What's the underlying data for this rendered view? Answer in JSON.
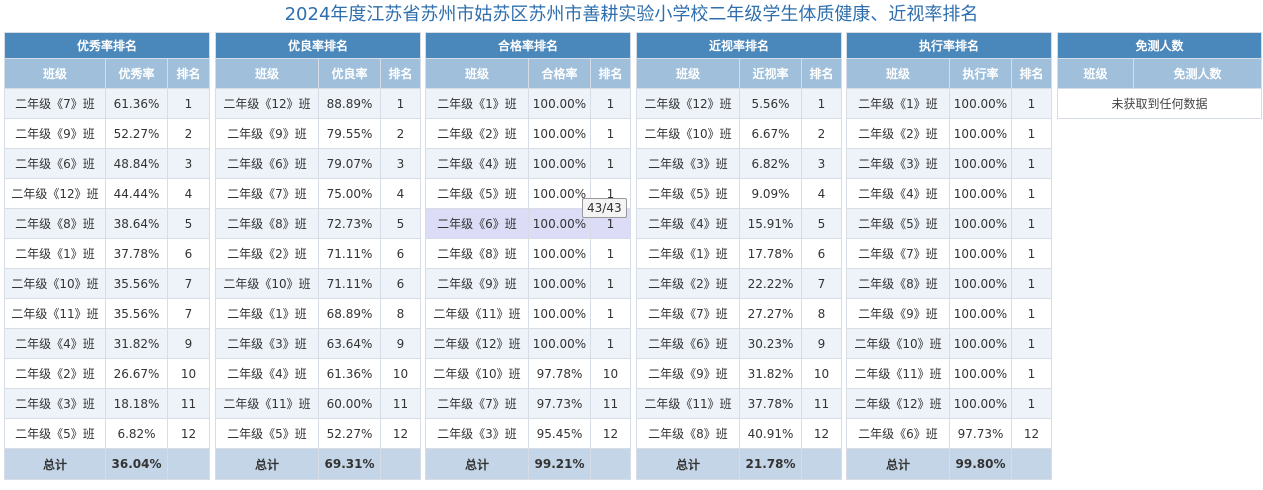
{
  "page": {
    "title": "2024年度江苏省苏州市姑苏区苏州市善耕实验小学校二年级学生体质健康、近视率排名"
  },
  "tables": [
    {
      "title": "优秀率排名",
      "columns": [
        "班级",
        "优秀率",
        "排名"
      ],
      "rows": [
        [
          "二年级《7》班",
          "61.36%",
          "1"
        ],
        [
          "二年级《9》班",
          "52.27%",
          "2"
        ],
        [
          "二年级《6》班",
          "48.84%",
          "3"
        ],
        [
          "二年级《12》班",
          "44.44%",
          "4"
        ],
        [
          "二年级《8》班",
          "38.64%",
          "5"
        ],
        [
          "二年级《1》班",
          "37.78%",
          "6"
        ],
        [
          "二年级《10》班",
          "35.56%",
          "7"
        ],
        [
          "二年级《11》班",
          "35.56%",
          "7"
        ],
        [
          "二年级《4》班",
          "31.82%",
          "9"
        ],
        [
          "二年级《2》班",
          "26.67%",
          "10"
        ],
        [
          "二年级《3》班",
          "18.18%",
          "11"
        ],
        [
          "二年级《5》班",
          "6.82%",
          "12"
        ]
      ],
      "total": [
        "总计",
        "36.04%",
        ""
      ]
    },
    {
      "title": "优良率排名",
      "columns": [
        "班级",
        "优良率",
        "排名"
      ],
      "rows": [
        [
          "二年级《12》班",
          "88.89%",
          "1"
        ],
        [
          "二年级《9》班",
          "79.55%",
          "2"
        ],
        [
          "二年级《6》班",
          "79.07%",
          "3"
        ],
        [
          "二年级《7》班",
          "75.00%",
          "4"
        ],
        [
          "二年级《8》班",
          "72.73%",
          "5"
        ],
        [
          "二年级《2》班",
          "71.11%",
          "6"
        ],
        [
          "二年级《10》班",
          "71.11%",
          "6"
        ],
        [
          "二年级《1》班",
          "68.89%",
          "8"
        ],
        [
          "二年级《3》班",
          "63.64%",
          "9"
        ],
        [
          "二年级《4》班",
          "61.36%",
          "10"
        ],
        [
          "二年级《11》班",
          "60.00%",
          "11"
        ],
        [
          "二年级《5》班",
          "52.27%",
          "12"
        ]
      ],
      "total": [
        "总计",
        "69.31%",
        ""
      ]
    },
    {
      "title": "合格率排名",
      "columns": [
        "班级",
        "合格率",
        "排名"
      ],
      "rows": [
        [
          "二年级《1》班",
          "100.00%",
          "1"
        ],
        [
          "二年级《2》班",
          "100.00%",
          "1"
        ],
        [
          "二年级《4》班",
          "100.00%",
          "1"
        ],
        [
          "二年级《5》班",
          "100.00%",
          "1"
        ],
        [
          "二年级《6》班",
          "100.00%",
          "1"
        ],
        [
          "二年级《8》班",
          "100.00%",
          "1"
        ],
        [
          "二年级《9》班",
          "100.00%",
          "1"
        ],
        [
          "二年级《11》班",
          "100.00%",
          "1"
        ],
        [
          "二年级《12》班",
          "100.00%",
          "1"
        ],
        [
          "二年级《10》班",
          "97.78%",
          "10"
        ],
        [
          "二年级《7》班",
          "97.73%",
          "11"
        ],
        [
          "二年级《3》班",
          "95.45%",
          "12"
        ]
      ],
      "total": [
        "总计",
        "99.21%",
        ""
      ],
      "highlight_row": 4
    },
    {
      "title": "近视率排名",
      "columns": [
        "班级",
        "近视率",
        "排名"
      ],
      "rows": [
        [
          "二年级《12》班",
          "5.56%",
          "1"
        ],
        [
          "二年级《10》班",
          "6.67%",
          "2"
        ],
        [
          "二年级《3》班",
          "6.82%",
          "3"
        ],
        [
          "二年级《5》班",
          "9.09%",
          "4"
        ],
        [
          "二年级《4》班",
          "15.91%",
          "5"
        ],
        [
          "二年级《1》班",
          "17.78%",
          "6"
        ],
        [
          "二年级《2》班",
          "22.22%",
          "7"
        ],
        [
          "二年级《7》班",
          "27.27%",
          "8"
        ],
        [
          "二年级《6》班",
          "30.23%",
          "9"
        ],
        [
          "二年级《9》班",
          "31.82%",
          "10"
        ],
        [
          "二年级《11》班",
          "37.78%",
          "11"
        ],
        [
          "二年级《8》班",
          "40.91%",
          "12"
        ]
      ],
      "total": [
        "总计",
        "21.78%",
        ""
      ]
    },
    {
      "title": "执行率排名",
      "columns": [
        "班级",
        "执行率",
        "排名"
      ],
      "rows": [
        [
          "二年级《1》班",
          "100.00%",
          "1"
        ],
        [
          "二年级《2》班",
          "100.00%",
          "1"
        ],
        [
          "二年级《3》班",
          "100.00%",
          "1"
        ],
        [
          "二年级《4》班",
          "100.00%",
          "1"
        ],
        [
          "二年级《5》班",
          "100.00%",
          "1"
        ],
        [
          "二年级《7》班",
          "100.00%",
          "1"
        ],
        [
          "二年级《8》班",
          "100.00%",
          "1"
        ],
        [
          "二年级《9》班",
          "100.00%",
          "1"
        ],
        [
          "二年级《10》班",
          "100.00%",
          "1"
        ],
        [
          "二年级《11》班",
          "100.00%",
          "1"
        ],
        [
          "二年级《12》班",
          "100.00%",
          "1"
        ],
        [
          "二年级《6》班",
          "97.73%",
          "12"
        ]
      ],
      "total": [
        "总计",
        "99.80%",
        ""
      ]
    }
  ],
  "exempt_table": {
    "title": "免测人数",
    "columns": [
      "班级",
      "免测人数"
    ],
    "empty_text": "未获取到任何数据"
  },
  "tooltip": {
    "text": "43/43"
  },
  "colors": {
    "title": "#2f6fae",
    "table_header": "#4a87bb",
    "column_header": "#9fbfdb",
    "total_row": "#c3d5e6",
    "row_stripe": "#eef3f9",
    "highlight": "#dcdcf7"
  }
}
